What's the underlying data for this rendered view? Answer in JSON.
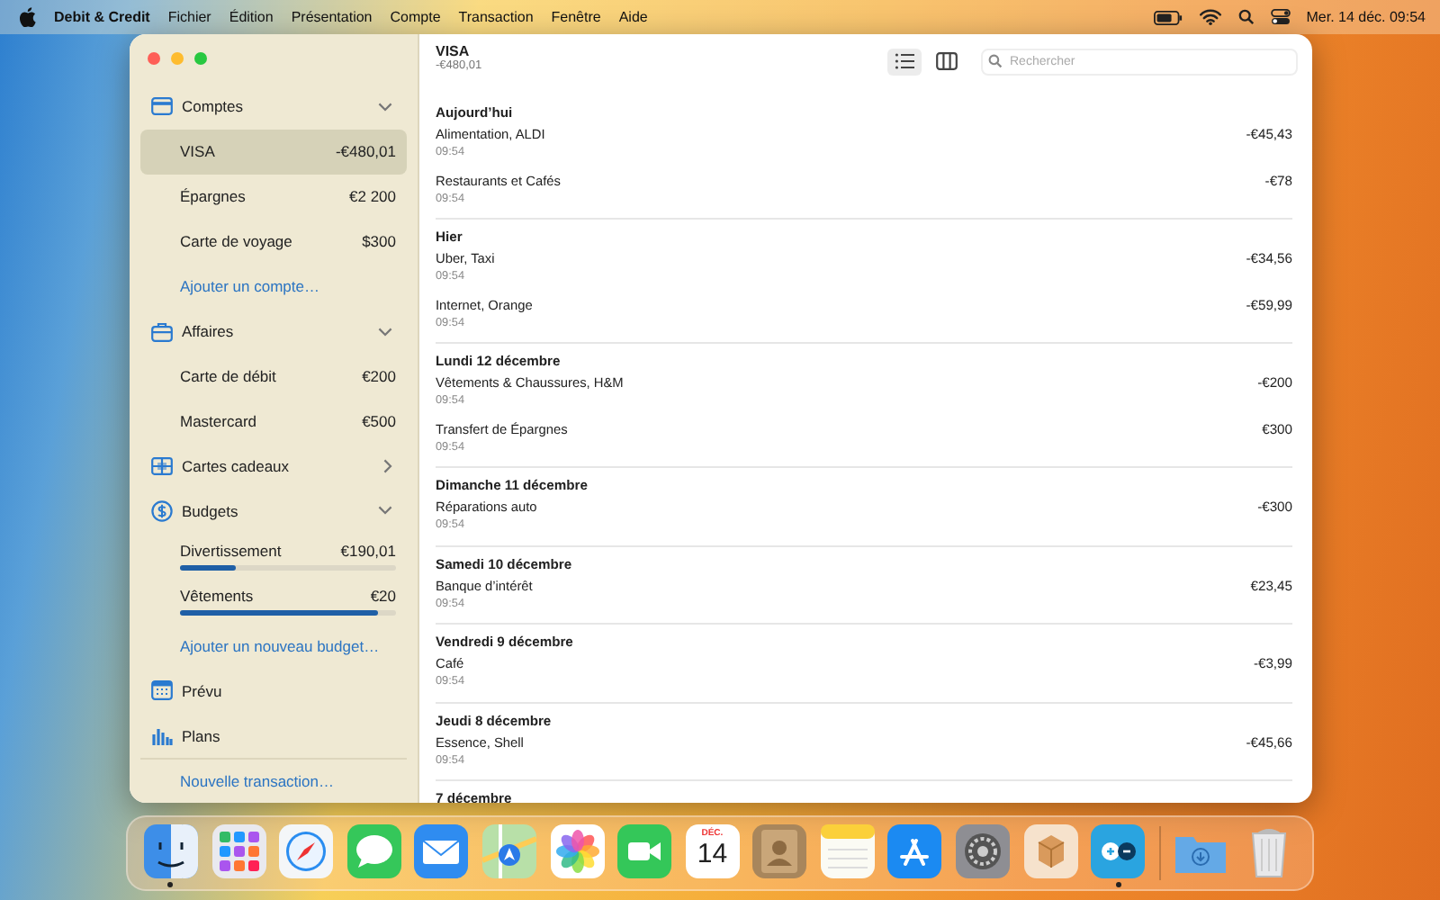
{
  "menubar": {
    "app_name": "Debit & Credit",
    "menus": [
      "Fichier",
      "Édition",
      "Présentation",
      "Compte",
      "Transaction",
      "Fenêtre",
      "Aide"
    ],
    "clock": "Mer. 14 déc. 09:54"
  },
  "sidebar": {
    "items": [
      {
        "kind": "accounts",
        "label": "Comptes",
        "expanded": true
      },
      {
        "kind": "account",
        "label": "VISA",
        "amount": "-€480,01",
        "selected": true
      },
      {
        "kind": "account",
        "label": "Épargnes",
        "amount": "€2 200",
        "selected": false
      },
      {
        "kind": "account",
        "label": "Carte de voyage",
        "amount": "$300",
        "selected": false
      },
      {
        "kind": "link",
        "label": "Ajouter un compte…"
      },
      {
        "kind": "business",
        "label": "Affaires",
        "expanded": true
      },
      {
        "kind": "account",
        "label": "Carte de débit",
        "amount": "€200",
        "selected": false
      },
      {
        "kind": "account",
        "label": "Mastercard",
        "amount": "€500",
        "selected": false
      },
      {
        "kind": "giftcards",
        "label": "Cartes cadeaux",
        "expanded": false
      },
      {
        "kind": "budgets",
        "label": "Budgets",
        "expanded": true
      },
      {
        "kind": "budget",
        "label": "Divertissement",
        "amount": "€190,01",
        "level": 0.26
      },
      {
        "kind": "budget",
        "label": "Vêtements",
        "amount": "€20",
        "level": 0.92
      },
      {
        "kind": "link",
        "label": "Ajouter un nouveau budget…"
      },
      {
        "kind": "forecast",
        "label": "Prévu",
        "selected": false
      },
      {
        "kind": "plans",
        "label": "Plans",
        "selected": false
      }
    ],
    "footer_link": "Nouvelle transaction…"
  },
  "main": {
    "title": "VISA",
    "balance": "-€480,01",
    "views": [
      {
        "kind": "list",
        "selected": true
      },
      {
        "kind": "columns",
        "selected": false
      }
    ],
    "search": {
      "placeholder": "Rechercher"
    },
    "groups": [
      {
        "date": "Aujourd’hui",
        "transactions": [
          {
            "name": "Alimentation, ALDI",
            "time": "09:54",
            "amount": "-€45,43"
          },
          {
            "name": "Restaurants et Cafés",
            "time": "09:54",
            "amount": "-€78"
          }
        ]
      },
      {
        "date": "Hier",
        "transactions": [
          {
            "name": "Uber, Taxi",
            "time": "09:54",
            "amount": "-€34,56"
          },
          {
            "name": "Internet, Orange",
            "time": "09:54",
            "amount": "-€59,99"
          }
        ]
      },
      {
        "date": "Lundi 12 décembre",
        "transactions": [
          {
            "name": "Vêtements & Chaussures, H&M",
            "time": "09:54",
            "amount": "-€200"
          },
          {
            "name": "Transfert de Épargnes",
            "time": "09:54",
            "amount": "€300"
          }
        ]
      },
      {
        "date": "Dimanche 11 décembre",
        "transactions": [
          {
            "name": "Réparations auto",
            "time": "09:54",
            "amount": "-€300"
          }
        ]
      },
      {
        "date": "Samedi 10 décembre",
        "transactions": [
          {
            "name": "Banque d’intérêt",
            "time": "09:54",
            "amount": "€23,45"
          }
        ]
      },
      {
        "date": "Vendredi 9 décembre",
        "transactions": [
          {
            "name": "Café",
            "time": "09:54",
            "amount": "-€3,99"
          }
        ]
      },
      {
        "date": "Jeudi 8 décembre",
        "transactions": [
          {
            "name": "Essence, Shell",
            "time": "09:54",
            "amount": "-€45,66"
          }
        ]
      },
      {
        "date": "7 décembre"
      }
    ]
  },
  "dock": [
    {
      "kind": "finder",
      "running": true
    },
    {
      "kind": "launchpad",
      "running": false
    },
    {
      "kind": "safari",
      "running": false
    },
    {
      "kind": "messages",
      "running": false
    },
    {
      "kind": "mail",
      "running": false
    },
    {
      "kind": "maps",
      "running": false
    },
    {
      "kind": "photos",
      "running": false
    },
    {
      "kind": "facetime",
      "running": false
    },
    {
      "kind": "calendar",
      "running": false,
      "month": "DÉC.",
      "day": "14"
    },
    {
      "kind": "contacts",
      "running": false
    },
    {
      "kind": "notes",
      "running": false
    },
    {
      "kind": "appstore",
      "running": false
    },
    {
      "kind": "settings",
      "running": false
    },
    {
      "kind": "package",
      "running": false
    },
    {
      "kind": "debitcredit",
      "running": true
    },
    {
      "kind": "divider"
    },
    {
      "kind": "downloads",
      "running": false
    },
    {
      "kind": "trash",
      "running": false
    }
  ]
}
